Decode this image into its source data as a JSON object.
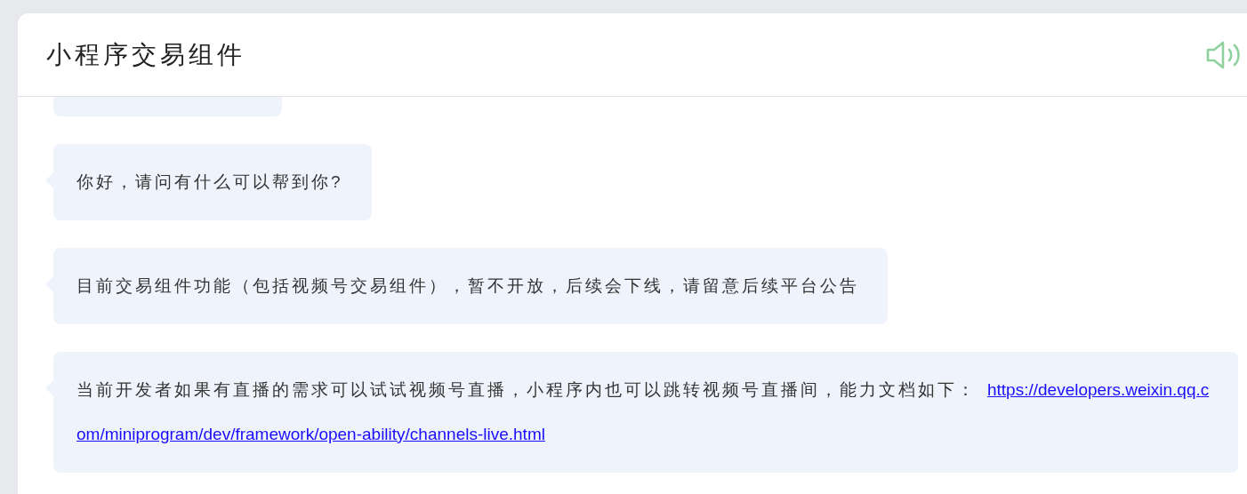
{
  "header": {
    "title": "小程序交易组件"
  },
  "messages": [
    {
      "kind": "partial"
    },
    {
      "kind": "text",
      "text": "你好，请问有什么可以帮到你?"
    },
    {
      "kind": "text",
      "text": "目前交易组件功能（包括视频号交易组件），暂不开放，后续会下线，请留意后续平台公告"
    },
    {
      "kind": "link",
      "text": "当前开发者如果有直播的需求可以试试视频号直播，小程序内也可以跳转视频号直播间，能力文档如下：",
      "link": "https://developers.weixin.qq.com/miniprogram/dev/framework/open-ability/channels-live.html"
    }
  ]
}
